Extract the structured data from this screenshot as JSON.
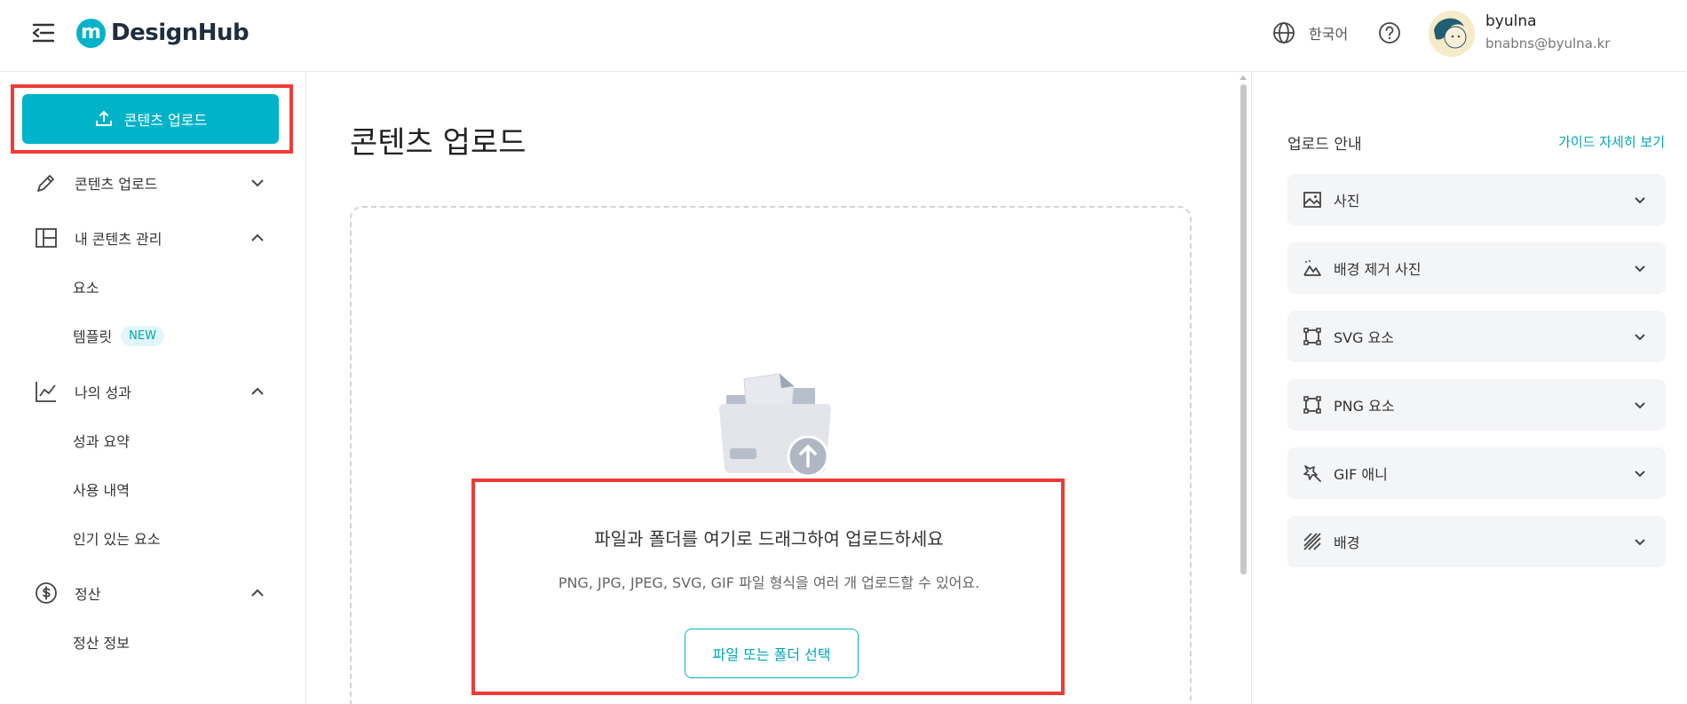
{
  "header": {
    "logo_mark": "m",
    "logo_text": "DesignHub",
    "language": "한국어",
    "user_name": "byulna",
    "user_email": "bnabns@byulna.kr"
  },
  "sidebar": {
    "upload_button": "콘텐츠 업로드",
    "items": [
      {
        "label": "콘텐츠 업로드",
        "icon": "pencil-icon",
        "chevron": "down"
      },
      {
        "label": "내 콘텐츠 관리",
        "icon": "layout-icon",
        "chevron": "up"
      },
      {
        "label": "나의 성과",
        "icon": "chart-line-icon",
        "chevron": "up"
      },
      {
        "label": "정산",
        "icon": "dollar-circle-icon",
        "chevron": "up"
      }
    ],
    "sub_items": {
      "manage": [
        "요소",
        "템플릿"
      ],
      "performance": [
        "성과 요약",
        "사용 내역",
        "인기 있는 요소"
      ],
      "settlement": [
        "정산 정보"
      ]
    },
    "new_badge": "NEW"
  },
  "main": {
    "title": "콘텐츠 업로드",
    "drop_title": "파일과 폴더를 여기로 드래그하여 업로드하세요",
    "drop_subtitle": "PNG, JPG, JPEG, SVG, GIF 파일 형식을 여러 개 업로드할 수 있어요.",
    "select_button": "파일 또는 폴더 선택"
  },
  "guide": {
    "title": "업로드 안내",
    "link": "가이드 자세히 보기",
    "items": [
      {
        "label": "사진",
        "icon": "image-icon"
      },
      {
        "label": "배경 제거 사진",
        "icon": "mountain-remove-icon"
      },
      {
        "label": "SVG 요소",
        "icon": "vector-square-icon"
      },
      {
        "label": "PNG 요소",
        "icon": "vector-square-icon"
      },
      {
        "label": "GIF 애니",
        "icon": "sparkle-icon"
      },
      {
        "label": "배경",
        "icon": "stripes-icon"
      }
    ]
  },
  "colors": {
    "accent": "#00b3c8",
    "highlight": "#ef3b36",
    "accordion_bg": "#f4f5f7"
  }
}
